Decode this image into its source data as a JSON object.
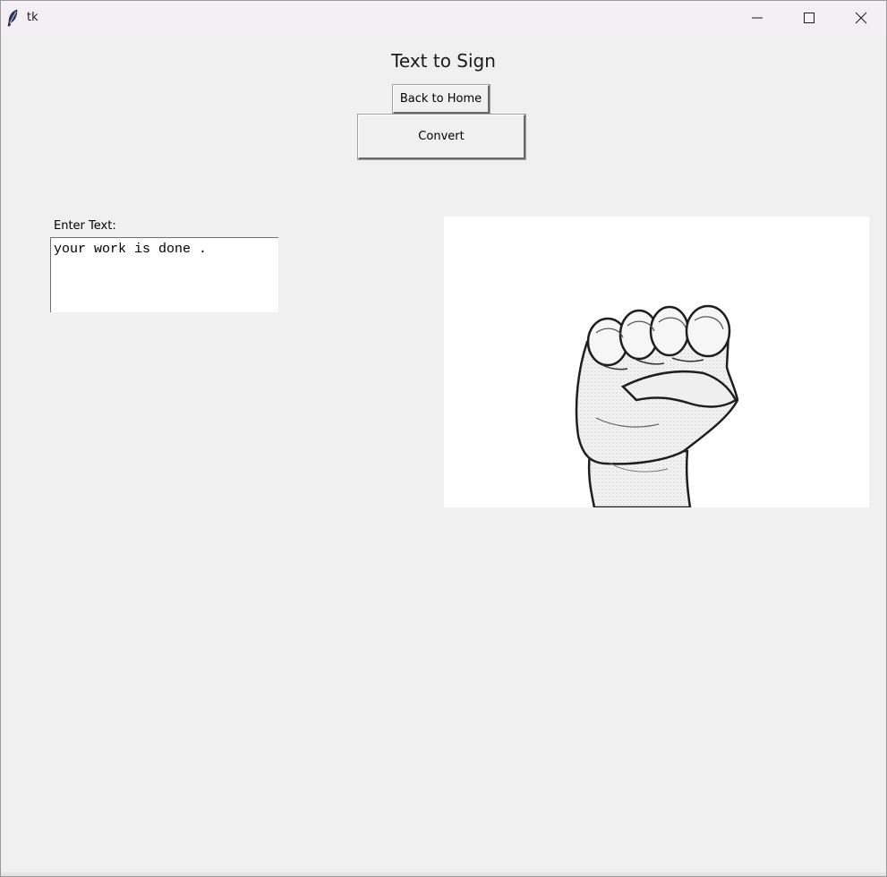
{
  "window": {
    "title": "tk"
  },
  "page": {
    "title": "Text to Sign",
    "back_button_label": "Back to Home",
    "convert_button_label": "Convert",
    "input_label": "Enter Text:",
    "input_value": "your work is done ."
  },
  "icons": {
    "app": "feather-icon",
    "minimize": "minimize-icon",
    "maximize": "maximize-icon",
    "close": "close-icon",
    "sign": "fist-hand-sign-image"
  },
  "colors": {
    "window_bg": "#f0f0f0",
    "titlebar_bg": "#f4eef5",
    "panel_bg": "#ffffff"
  }
}
